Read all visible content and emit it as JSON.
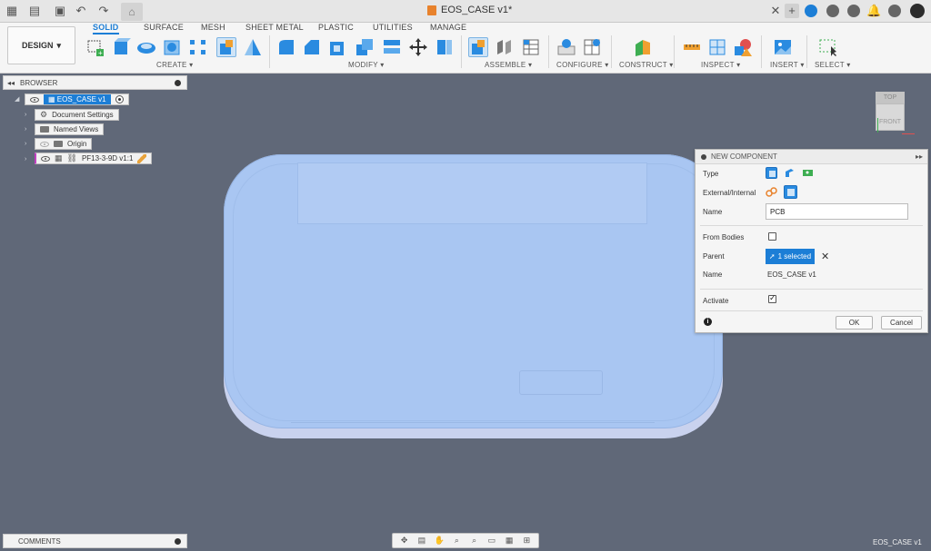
{
  "titlebar": {
    "document_title": "EOS_CASE v1*"
  },
  "ribbon": {
    "workspace_button": "DESIGN",
    "tabs": [
      "SOLID",
      "SURFACE",
      "MESH",
      "SHEET METAL",
      "PLASTIC",
      "UTILITIES",
      "MANAGE"
    ],
    "active_tab": "SOLID",
    "groups": [
      "CREATE",
      "MODIFY",
      "ASSEMBLE",
      "CONFIGURE",
      "CONSTRUCT",
      "INSPECT",
      "INSERT",
      "SELECT"
    ],
    "accent_color": "#1c7ed6"
  },
  "browser": {
    "title": "BROWSER",
    "items": [
      {
        "label": "EOS_CASE v1",
        "icon": "component-icon"
      },
      {
        "label": "Document Settings",
        "icon": "gear-icon"
      },
      {
        "label": "Named Views",
        "icon": "folder-icon"
      },
      {
        "label": "Origin",
        "icon": "folder-icon"
      },
      {
        "label": "PF13-3-9D v1:1",
        "icon": "link-icon"
      }
    ]
  },
  "viewcube": {
    "top": "TOP",
    "front": "FRONT"
  },
  "dialog": {
    "title": "NEW COMPONENT",
    "type_label": "Type",
    "external_internal_label": "External/Internal",
    "name_label": "Name",
    "name_value": "PCB",
    "from_bodies_label": "From Bodies",
    "from_bodies_checked": false,
    "parent_label": "Parent",
    "parent_selection": "1 selected",
    "parent_name_label": "Name",
    "parent_name_value": "EOS_CASE v1",
    "activate_label": "Activate",
    "activate_checked": true,
    "ok_label": "OK",
    "cancel_label": "Cancel"
  },
  "comments": {
    "title": "COMMENTS"
  },
  "status": {
    "document_name": "EOS_CASE v1"
  }
}
